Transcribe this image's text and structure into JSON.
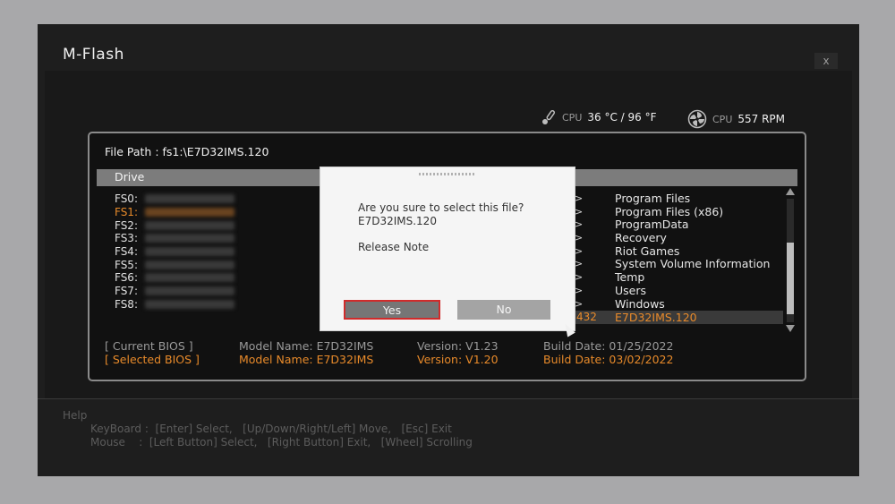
{
  "app": {
    "title": "M-Flash",
    "close_label": "x"
  },
  "status": {
    "temp_label": "CPU",
    "temp_value": "36 °C / 96 °F",
    "fan_label": "CPU",
    "fan_value": "557 RPM"
  },
  "file_browser": {
    "file_path": "File Path :  fs1:\\E7D32IMS.120",
    "drive_header": "Drive",
    "drives": [
      {
        "label": "FS0:"
      },
      {
        "label": "FS1:"
      },
      {
        "label": "FS2:"
      },
      {
        "label": "FS3:"
      },
      {
        "label": "FS4:"
      },
      {
        "label": "FS5:"
      },
      {
        "label": "FS6:"
      },
      {
        "label": "FS7:"
      },
      {
        "label": "FS8:"
      }
    ],
    "arrows": [
      ">",
      ">",
      ">",
      ">",
      ">",
      ">",
      ">",
      ">",
      ">"
    ],
    "folders": [
      "Program Files",
      "Program Files (x86)",
      "ProgramData",
      "Recovery",
      "Riot Games",
      "System Volume Information",
      "Temp",
      "Users",
      "Windows"
    ],
    "selected_file": {
      "size": "432",
      "name": "E7D32IMS.120"
    }
  },
  "bios": {
    "current": {
      "label": "[ Current BIOS  ]",
      "model": "Model Name: E7D32IMS",
      "version": "Version: V1.23",
      "build": "Build Date: 01/25/2022"
    },
    "selected": {
      "label": "[ Selected BIOS ]",
      "model": "Model Name: E7D32IMS",
      "version": "Version: V1.20",
      "build": "Build Date: 03/02/2022"
    }
  },
  "help": {
    "title": "Help",
    "keyboard": "KeyBoard :  [Enter] Select,   [Up/Down/Right/Left] Move,   [Esc] Exit",
    "mouse": "Mouse    :  [Left Button] Select,   [Right Button] Exit,   [Wheel] Scrolling"
  },
  "dialog": {
    "message": "Are you sure to select this file?",
    "file": "E7D32IMS.120",
    "note": "Release Note",
    "yes_label": "Yes",
    "no_label": "No"
  },
  "colors": {
    "accent": "#e88a2a",
    "focus_border": "#d02b2b"
  }
}
